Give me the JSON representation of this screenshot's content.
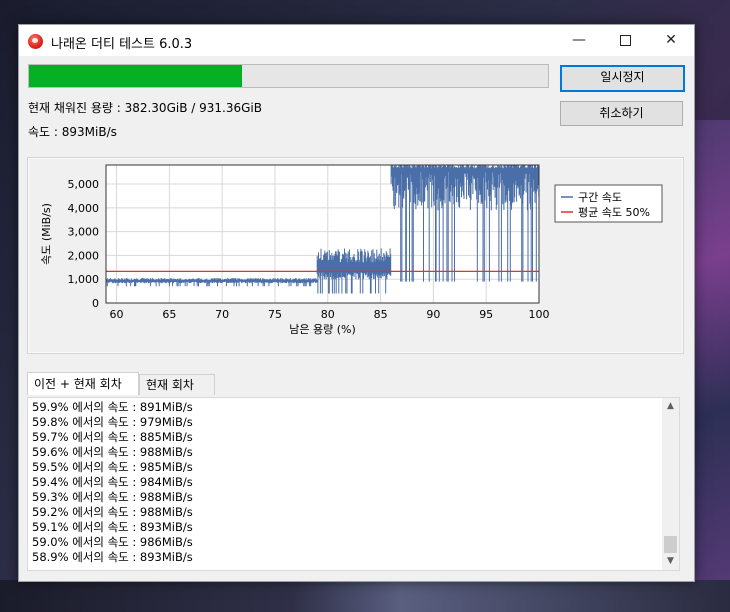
{
  "window": {
    "title": "나래온 더티 테스트 6.0.3",
    "minimize_glyph": "—",
    "close_glyph": "✕"
  },
  "progress": {
    "fraction": 0.41
  },
  "buttons": {
    "pause_label": "일시정지",
    "cancel_label": "취소하기"
  },
  "status": {
    "capacity_text": "현재 채워진 용량 : 382.30GiB / 931.36GiB",
    "speed_text": "속도 : 893MiB/s"
  },
  "chart_data": {
    "type": "line",
    "xlabel": "남은 용량 (%)",
    "ylabel": "속도 (MiB/s)",
    "xlim": [
      59,
      100
    ],
    "ylim": [
      0,
      5800
    ],
    "x_ticks": [
      "60",
      "65",
      "70",
      "75",
      "80",
      "85",
      "90",
      "95",
      "100"
    ],
    "y_ticks": [
      "0",
      "1,000",
      "2,000",
      "3,000",
      "4,000",
      "5,000"
    ],
    "grid": true,
    "legend": "right",
    "series": [
      {
        "name": "구간 속도",
        "color": "#4a6ea8",
        "segments": [
          {
            "x_from": 59,
            "x_to": 79,
            "min": 700,
            "max": 1050,
            "typical": 900
          },
          {
            "x_from": 79,
            "x_to": 86,
            "min": 400,
            "max": 2300,
            "typical": 1300
          },
          {
            "x_from": 86,
            "x_to": 100,
            "min": 900,
            "max": 5900,
            "typical": 5500
          }
        ]
      },
      {
        "name": "평균 속도 50%",
        "color": "#e03030",
        "constant": 1330
      }
    ]
  },
  "tabs": {
    "previous_current": "이전 + 현재 회차",
    "current": "현재 회차"
  },
  "log": [
    "59.9% 에서의 속도 : 891MiB/s",
    "59.8% 에서의 속도 : 979MiB/s",
    "59.7% 에서의 속도 : 885MiB/s",
    "59.6% 에서의 속도 : 988MiB/s",
    "59.5% 에서의 속도 : 985MiB/s",
    "59.4% 에서의 속도 : 984MiB/s",
    "59.3% 에서의 속도 : 988MiB/s",
    "59.2% 에서의 속도 : 988MiB/s",
    "59.1% 에서의 속도 : 893MiB/s",
    "59.0% 에서의 속도 : 986MiB/s",
    "58.9% 에서의 속도 : 893MiB/s"
  ],
  "scroll": {
    "up_glyph": "▲",
    "down_glyph": "▼"
  }
}
